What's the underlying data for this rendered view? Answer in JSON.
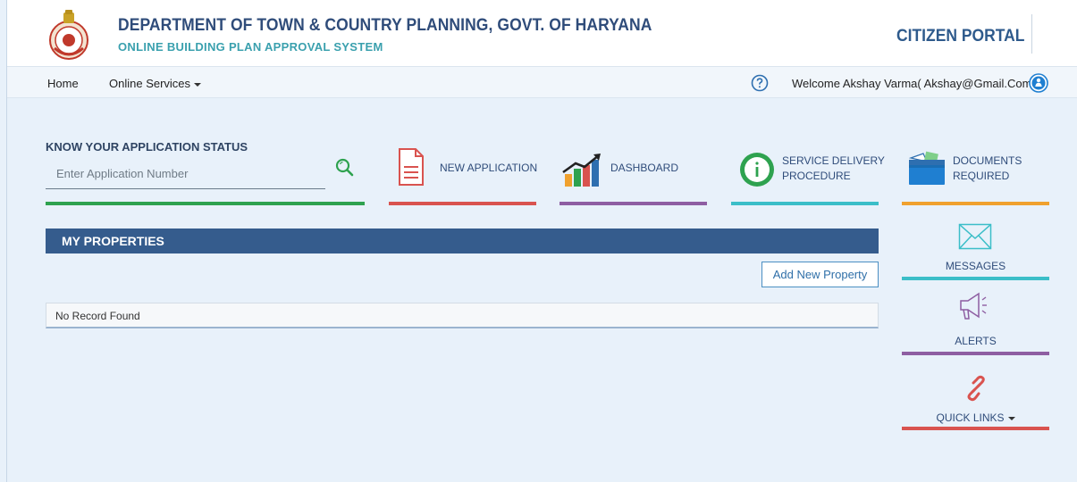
{
  "header": {
    "title": "DEPARTMENT OF TOWN & COUNTRY PLANNING, GOVT. OF HARYANA",
    "subtitle": "ONLINE BUILDING PLAN APPROVAL SYSTEM",
    "portal": "CITIZEN PORTAL",
    "logo_icon": "haryana-emblem-icon"
  },
  "nav": {
    "home": "Home",
    "online_services": "Online Services",
    "help_icon": "question-circle-icon",
    "welcome": "Welcome Akshay Varma( Akshay@Gmail.Com)",
    "user_icon": "user-circle-icon"
  },
  "status": {
    "title": "KNOW YOUR APPLICATION STATUS",
    "placeholder": "Enter Application Number",
    "value": "",
    "search_icon": "search-icon"
  },
  "tiles": [
    {
      "label": "NEW APPLICATION",
      "icon": "document-icon",
      "color": "#d9534f"
    },
    {
      "label": "DASHBOARD",
      "icon": "bar-chart-icon",
      "color": "#8e5ea2"
    },
    {
      "label_line1": "SERVICE DELIVERY",
      "label_line2": "PROCEDURE",
      "icon": "info-circle-icon",
      "color": "#3bbec8"
    },
    {
      "label_line1": "DOCUMENTS",
      "label_line2": "REQUIRED",
      "icon": "folder-icon",
      "color": "#f0a12e"
    }
  ],
  "status_bar_color": "#2ea24f",
  "properties": {
    "title": "MY PROPERTIES",
    "add_button": "Add New Property",
    "empty_text": "No Record Found"
  },
  "side": {
    "messages": "MESSAGES",
    "alerts": "ALERTS",
    "quick_links": "QUICK LINKS"
  },
  "colors": {
    "brand": "#2f4c7a",
    "accent": "#3aa0ae",
    "messages_bar": "#3bbec8",
    "alerts_bar": "#8e5ea2",
    "quick_links_bar": "#d9534f"
  }
}
